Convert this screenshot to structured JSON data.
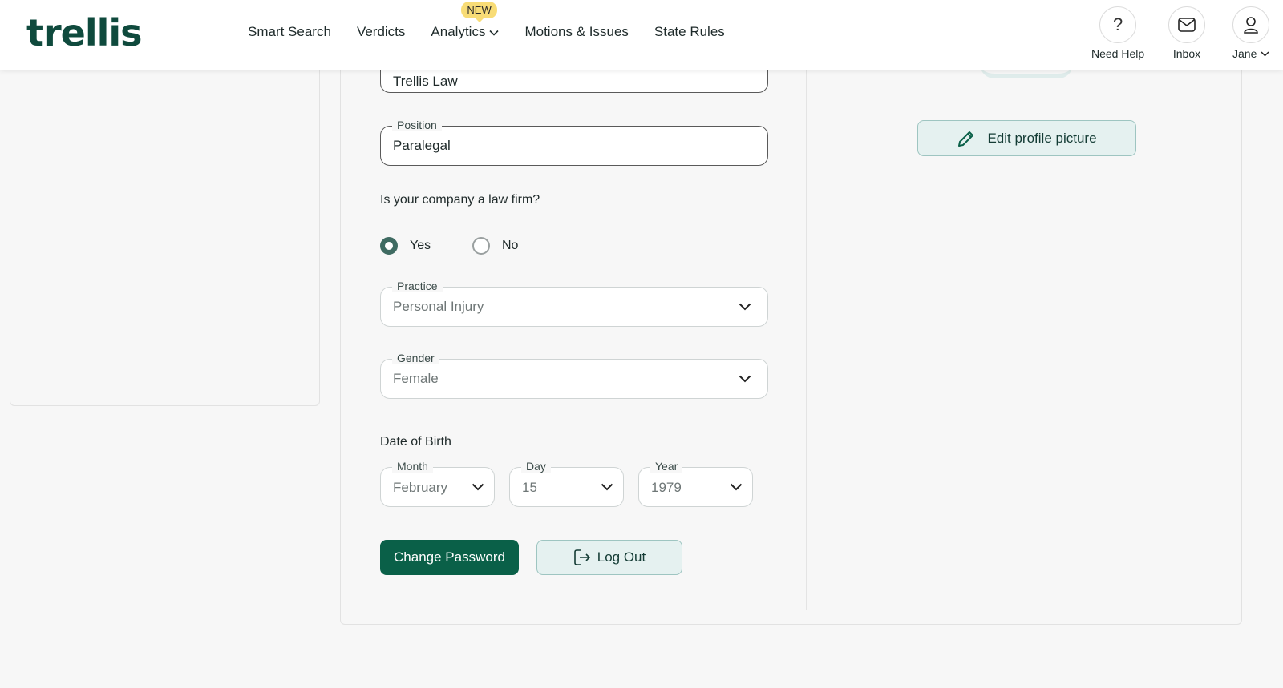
{
  "brand": {
    "logo_text": "trellis"
  },
  "nav": {
    "items": [
      {
        "label": "Smart Search"
      },
      {
        "label": "Verdicts"
      },
      {
        "label": "Analytics",
        "badge": "NEW",
        "has_dropdown": true
      },
      {
        "label": "Motions & Issues"
      },
      {
        "label": "State Rules"
      }
    ]
  },
  "header_actions": {
    "help": {
      "label": "Need Help",
      "icon": "question-icon"
    },
    "inbox": {
      "label": "Inbox",
      "icon": "envelope-icon"
    },
    "user": {
      "label": "Jane",
      "icon": "user-icon"
    }
  },
  "form": {
    "company": {
      "value": "Trellis Law"
    },
    "position": {
      "label": "Position",
      "value": "Paralegal"
    },
    "law_firm_question": "Is your company a law firm?",
    "law_firm_options": {
      "yes": "Yes",
      "no": "No",
      "selected": "Yes"
    },
    "practice": {
      "label": "Practice",
      "value": "Personal Injury"
    },
    "gender": {
      "label": "Gender",
      "value": "Female"
    },
    "dob": {
      "label": "Date of Birth",
      "month": {
        "label": "Month",
        "value": "February"
      },
      "day": {
        "label": "Day",
        "value": "15"
      },
      "year": {
        "label": "Year",
        "value": "1979"
      }
    },
    "change_password_label": "Change Password",
    "logout_label": "Log Out"
  },
  "profile": {
    "edit_picture_label": "Edit profile picture"
  },
  "colors": {
    "brand_green": "#0a6048",
    "logo_green": "#0f4a3d",
    "badge_yellow": "#f8dc76",
    "soft_teal": "#e5f1f0"
  }
}
